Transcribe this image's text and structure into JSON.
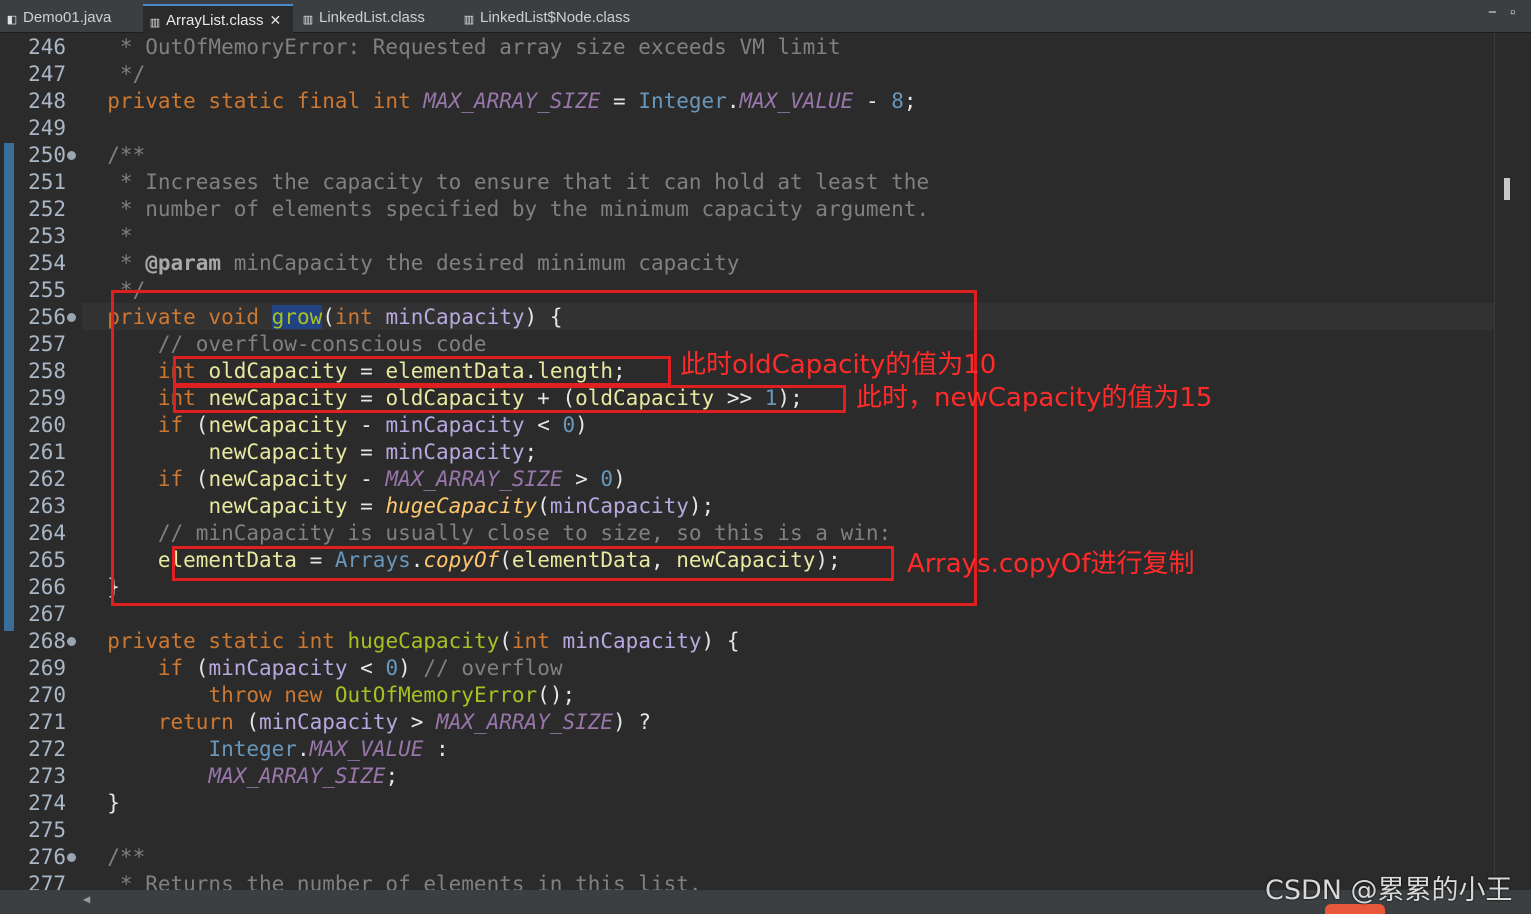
{
  "tabs": [
    {
      "label": "Demo01.java",
      "icon": "java-file-icon",
      "active": false
    },
    {
      "label": "ArrayList.class",
      "icon": "class-file-icon",
      "active": true,
      "close": "✕"
    },
    {
      "label": "LinkedList.class",
      "icon": "class-file-icon",
      "active": false
    },
    {
      "label": "LinkedList$Node.class",
      "icon": "class-file-icon",
      "active": false
    }
  ],
  "window_controls": {
    "minimize": "−",
    "maximize": "▫"
  },
  "gutter": {
    "line_numbers": [
      "246",
      "247",
      "248",
      "249",
      "250",
      "251",
      "252",
      "253",
      "254",
      "255",
      "256",
      "257",
      "258",
      "259",
      "260",
      "261",
      "262",
      "263",
      "264",
      "265",
      "266",
      "267",
      "268",
      "269",
      "270",
      "271",
      "272",
      "273",
      "274",
      "275",
      "276",
      "277"
    ],
    "folded_lines": [
      "250",
      "256",
      "268",
      "276"
    ]
  },
  "code_lines": [
    [
      {
        "t": "   * OutOfMemoryError: Requested array size exceeds VM limit",
        "c": "cm"
      }
    ],
    [
      {
        "t": "   */",
        "c": "cm"
      }
    ],
    [
      {
        "t": "  private static final int ",
        "c": "k"
      },
      {
        "t": "MAX_ARRAY_SIZE",
        "c": "cn"
      },
      {
        "t": " = ",
        "c": "op"
      },
      {
        "t": "Integer",
        "c": "cl"
      },
      {
        "t": ".",
        "c": "op"
      },
      {
        "t": "MAX_VALUE",
        "c": "cn"
      },
      {
        "t": " - ",
        "c": "op"
      },
      {
        "t": "8",
        "c": "nm"
      },
      {
        "t": ";",
        "c": "op"
      }
    ],
    [],
    [
      {
        "t": "  /**",
        "c": "cm"
      }
    ],
    [
      {
        "t": "   * Increases the capacity to ensure that it can hold at least the",
        "c": "cm"
      }
    ],
    [
      {
        "t": "   * number of elements specified by the minimum capacity argument.",
        "c": "cm"
      }
    ],
    [
      {
        "t": "   *",
        "c": "cm"
      }
    ],
    [
      {
        "t": "   * ",
        "c": "cm"
      },
      {
        "t": "@param",
        "c": "tag"
      },
      {
        "t": " minCapacity the desired minimum capacity",
        "c": "cm"
      }
    ],
    [
      {
        "t": "   */",
        "c": "cm"
      }
    ],
    [
      {
        "t": "  private void ",
        "c": "k"
      },
      {
        "t": "grow",
        "c": "md sel"
      },
      {
        "t": "(",
        "c": "op"
      },
      {
        "t": "int ",
        "c": "k"
      },
      {
        "t": "minCapacity",
        "c": "pr"
      },
      {
        "t": ") {",
        "c": "op"
      }
    ],
    [
      {
        "t": "      // overflow-conscious code",
        "c": "cm"
      }
    ],
    [
      {
        "t": "      ",
        "c": "op"
      },
      {
        "t": "int ",
        "c": "k"
      },
      {
        "t": "oldCapacity",
        "c": "lv"
      },
      {
        "t": " = ",
        "c": "op"
      },
      {
        "t": "elementData",
        "c": "lv"
      },
      {
        "t": ".",
        "c": "op"
      },
      {
        "t": "length",
        "c": "lv"
      },
      {
        "t": ";",
        "c": "op"
      }
    ],
    [
      {
        "t": "      ",
        "c": "op"
      },
      {
        "t": "int ",
        "c": "k"
      },
      {
        "t": "newCapacity",
        "c": "lv"
      },
      {
        "t": " = ",
        "c": "op"
      },
      {
        "t": "oldCapacity",
        "c": "lv"
      },
      {
        "t": " + (",
        "c": "op"
      },
      {
        "t": "oldCapacity",
        "c": "lv"
      },
      {
        "t": " >> ",
        "c": "op"
      },
      {
        "t": "1",
        "c": "nm"
      },
      {
        "t": ");",
        "c": "op"
      }
    ],
    [
      {
        "t": "      ",
        "c": "op"
      },
      {
        "t": "if ",
        "c": "k"
      },
      {
        "t": "(",
        "c": "op"
      },
      {
        "t": "newCapacity",
        "c": "lv"
      },
      {
        "t": " - ",
        "c": "op"
      },
      {
        "t": "minCapacity",
        "c": "pr"
      },
      {
        "t": " < ",
        "c": "op"
      },
      {
        "t": "0",
        "c": "nm"
      },
      {
        "t": ")",
        "c": "op"
      }
    ],
    [
      {
        "t": "          ",
        "c": "op"
      },
      {
        "t": "newCapacity",
        "c": "lv"
      },
      {
        "t": " = ",
        "c": "op"
      },
      {
        "t": "minCapacity",
        "c": "pr"
      },
      {
        "t": ";",
        "c": "op"
      }
    ],
    [
      {
        "t": "      ",
        "c": "op"
      },
      {
        "t": "if ",
        "c": "k"
      },
      {
        "t": "(",
        "c": "op"
      },
      {
        "t": "newCapacity",
        "c": "lv"
      },
      {
        "t": " - ",
        "c": "op"
      },
      {
        "t": "MAX_ARRAY_SIZE",
        "c": "cn"
      },
      {
        "t": " > ",
        "c": "op"
      },
      {
        "t": "0",
        "c": "nm"
      },
      {
        "t": ")",
        "c": "op"
      }
    ],
    [
      {
        "t": "          ",
        "c": "op"
      },
      {
        "t": "newCapacity",
        "c": "lv"
      },
      {
        "t": " = ",
        "c": "op"
      },
      {
        "t": "hugeCapacity",
        "c": "mc"
      },
      {
        "t": "(",
        "c": "op"
      },
      {
        "t": "minCapacity",
        "c": "pr"
      },
      {
        "t": ");",
        "c": "op"
      }
    ],
    [
      {
        "t": "      // minCapacity is usually close to size, so this is a win:",
        "c": "cm"
      }
    ],
    [
      {
        "t": "      ",
        "c": "op"
      },
      {
        "t": "elementData",
        "c": "lv"
      },
      {
        "t": " = ",
        "c": "op"
      },
      {
        "t": "Arrays",
        "c": "cl"
      },
      {
        "t": ".",
        "c": "op"
      },
      {
        "t": "copyOf",
        "c": "mc"
      },
      {
        "t": "(",
        "c": "op"
      },
      {
        "t": "elementData",
        "c": "lv"
      },
      {
        "t": ", ",
        "c": "op"
      },
      {
        "t": "newCapacity",
        "c": "lv"
      },
      {
        "t": ");",
        "c": "op"
      }
    ],
    [
      {
        "t": "  }",
        "c": "op"
      }
    ],
    [],
    [
      {
        "t": "  private static int ",
        "c": "k"
      },
      {
        "t": "hugeCapacity",
        "c": "md"
      },
      {
        "t": "(",
        "c": "op"
      },
      {
        "t": "int ",
        "c": "k"
      },
      {
        "t": "minCapacity",
        "c": "pr"
      },
      {
        "t": ") {",
        "c": "op"
      }
    ],
    [
      {
        "t": "      ",
        "c": "op"
      },
      {
        "t": "if ",
        "c": "k"
      },
      {
        "t": "(",
        "c": "op"
      },
      {
        "t": "minCapacity",
        "c": "pr"
      },
      {
        "t": " < ",
        "c": "op"
      },
      {
        "t": "0",
        "c": "nm"
      },
      {
        "t": ") ",
        "c": "op"
      },
      {
        "t": "// overflow",
        "c": "cm"
      }
    ],
    [
      {
        "t": "          ",
        "c": "op"
      },
      {
        "t": "throw new ",
        "c": "k"
      },
      {
        "t": "OutOfMemoryError",
        "c": "md"
      },
      {
        "t": "();",
        "c": "op"
      }
    ],
    [
      {
        "t": "      ",
        "c": "op"
      },
      {
        "t": "return ",
        "c": "k"
      },
      {
        "t": "(",
        "c": "op"
      },
      {
        "t": "minCapacity",
        "c": "pr"
      },
      {
        "t": " > ",
        "c": "op"
      },
      {
        "t": "MAX_ARRAY_SIZE",
        "c": "cn"
      },
      {
        "t": ") ?",
        "c": "op"
      }
    ],
    [
      {
        "t": "          ",
        "c": "op"
      },
      {
        "t": "Integer",
        "c": "cl"
      },
      {
        "t": ".",
        "c": "op"
      },
      {
        "t": "MAX_VALUE",
        "c": "cn"
      },
      {
        "t": " :",
        "c": "op"
      }
    ],
    [
      {
        "t": "          ",
        "c": "op"
      },
      {
        "t": "MAX_ARRAY_SIZE",
        "c": "cn"
      },
      {
        "t": ";",
        "c": "op"
      }
    ],
    [
      {
        "t": "  }",
        "c": "op"
      }
    ],
    [],
    [
      {
        "t": "  /**",
        "c": "cm"
      }
    ],
    [
      {
        "t": "   * Returns the number of elements in this list.",
        "c": "cm"
      }
    ]
  ],
  "annotations": {
    "old_capacity": "此时oldCapacity的值为10",
    "new_capacity": "此时，newCapacity的值为15",
    "copy_of": "Arrays.copyOf进行复制"
  },
  "watermark": "CSDN @累累的小王",
  "colors": {
    "annotation_red": "#e02020",
    "editor_bg": "#2b2b2b",
    "keyword": "#cc7832",
    "comment": "#808080"
  }
}
